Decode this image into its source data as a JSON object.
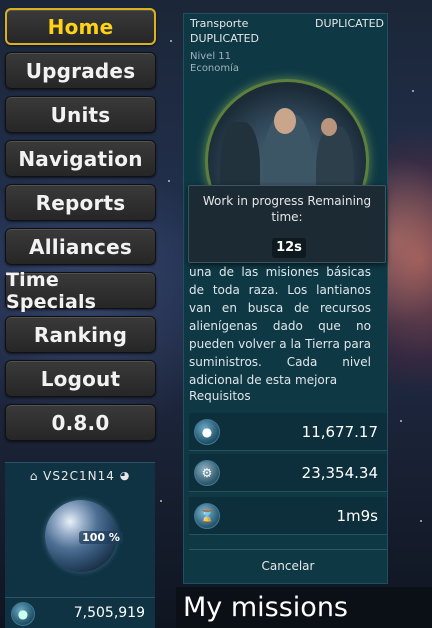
{
  "menu": {
    "items": [
      {
        "label": "Home"
      },
      {
        "label": "Upgrades"
      },
      {
        "label": "Units"
      },
      {
        "label": "Navigation"
      },
      {
        "label": "Reports"
      },
      {
        "label": "Alliances"
      },
      {
        "label": "Time Specials"
      },
      {
        "label": "Ranking"
      },
      {
        "label": "Logout"
      },
      {
        "label": "0.8.0"
      }
    ],
    "active": "Home"
  },
  "planet": {
    "name": "VS2C1N14",
    "percent": "100 %",
    "resource_value": "7,505,919",
    "home_icon": "home-icon",
    "globe_icon": "globe-icon"
  },
  "upgrade": {
    "category": "Transporte",
    "dup_top": "DUPLICATED",
    "dup_second": "DUPLICATED",
    "level": "Nivel 11",
    "type": "Economía",
    "progress_text": "Work in progress Remaining time:",
    "remaining": "12s",
    "description": "una de las misiones básicas de toda raza. Los lantianos van en busca de recursos alienígenas dado que no pueden volver a la Tierra para suministros. Cada nivel adicional de esta mejora",
    "requirements_label": "Requisitos",
    "costs": [
      {
        "icon": "credits-icon",
        "value": "11,677.17"
      },
      {
        "icon": "gear-icon",
        "value": "23,354.34"
      },
      {
        "icon": "time-icon",
        "value": "1m9s"
      }
    ],
    "cancel_label": "Cancelar"
  },
  "missions": {
    "title": "My missions"
  }
}
